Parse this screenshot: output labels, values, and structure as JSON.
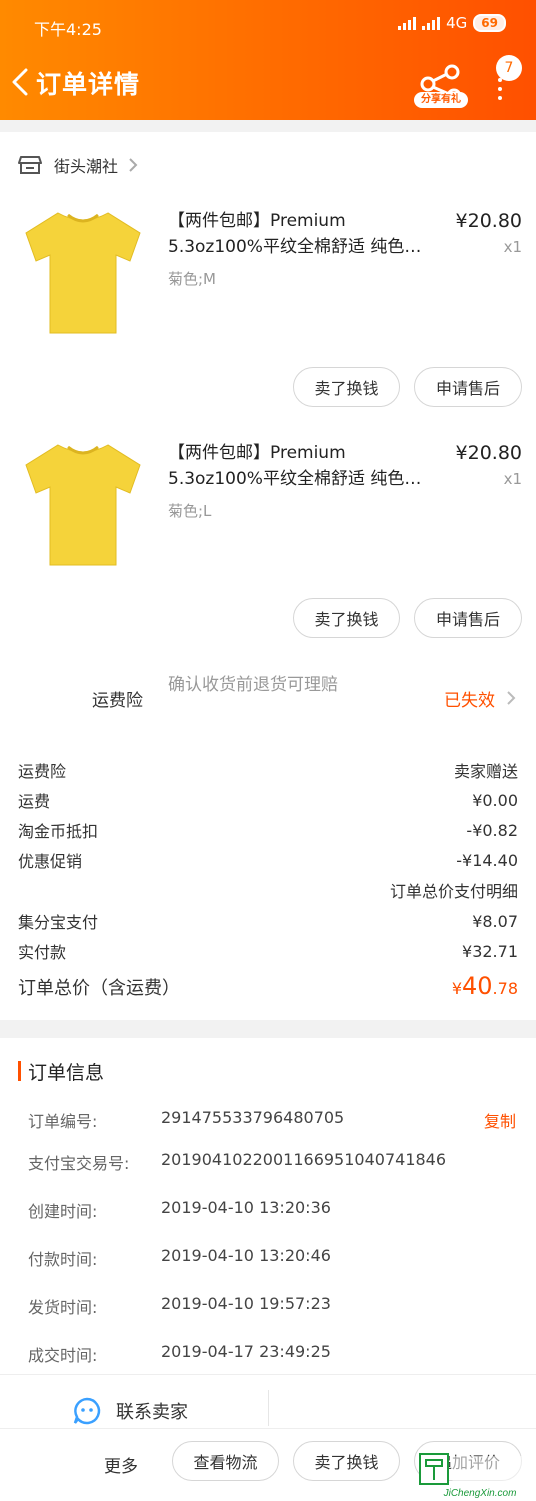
{
  "status_bar": {
    "time": "下午4:25",
    "network": "4G",
    "battery": "69"
  },
  "header": {
    "title": "订单详情",
    "share_label": "分享有礼",
    "badge_count": "7",
    "accent_color": "#ff6a00"
  },
  "store": {
    "name": "街头潮社",
    "icon": "store-icon"
  },
  "products": [
    {
      "title_line1": "【两件包邮】Premium",
      "title_line2": "5.3oz100%平纹全棉舒适 纯色…",
      "sku": "菊色;M",
      "price": "¥20.80",
      "qty": "x1",
      "btn_sell": "卖了换钱",
      "btn_after_sale": "申请售后"
    },
    {
      "title_line1": "【两件包邮】Premium",
      "title_line2": "5.3oz100%平纹全棉舒适 纯色…",
      "sku": "菊色;L",
      "price": "¥20.80",
      "qty": "x1",
      "btn_sell": "卖了换钱",
      "btn_after_sale": "申请售后"
    }
  ],
  "insurance": {
    "label": "运费险",
    "desc": "确认收货前退货可理赔",
    "status": "已失效"
  },
  "fees": [
    {
      "label": "运费险",
      "value": "卖家赠送"
    },
    {
      "label": "运费",
      "value": "¥0.00"
    },
    {
      "label": "淘金币抵扣",
      "value": "-¥0.82"
    },
    {
      "label": "优惠促销",
      "value": "-¥14.40"
    },
    {
      "label": "",
      "value": "订单总价支付明细"
    },
    {
      "label": "集分宝支付",
      "value": "¥8.07"
    },
    {
      "label": "实付款",
      "value": "¥32.71"
    }
  ],
  "total": {
    "label": "订单总价（含运费）",
    "currency": "¥",
    "integer": "40",
    "decimal": ".78"
  },
  "order_info": {
    "heading": "订单信息",
    "copy_label": "复制",
    "rows": [
      {
        "label": "订单编号:",
        "value": "291475533796480705"
      },
      {
        "label": "支付宝交易号:",
        "value": "2019041022001166951040741846"
      },
      {
        "label": "创建时间:",
        "value": "2019-04-10 13:20:36"
      },
      {
        "label": "付款时间:",
        "value": "2019-04-10 13:20:46"
      },
      {
        "label": "发货时间:",
        "value": "2019-04-10 19:57:23"
      },
      {
        "label": "成交时间:",
        "value": "2019-04-17 23:49:25"
      }
    ]
  },
  "contact": {
    "label": "联系卖家"
  },
  "bottom_bar": {
    "more": "更多",
    "logistics": "查看物流",
    "sell": "卖了换钱",
    "review": "追加评价"
  },
  "watermark": {
    "text": "JiChengXin.com"
  }
}
